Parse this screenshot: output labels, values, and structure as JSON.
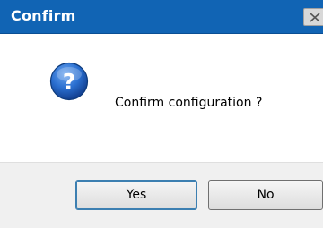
{
  "window": {
    "title": "Confirm",
    "close_icon": "close-icon"
  },
  "message": {
    "icon": "question-icon",
    "text": "Confirm configuration ?"
  },
  "buttons": {
    "yes_label": "Yes",
    "no_label": "No"
  },
  "colors": {
    "titlebar": "#1164b4",
    "footer": "#f0f0f0",
    "icon_blue": "#1b5fb5"
  }
}
